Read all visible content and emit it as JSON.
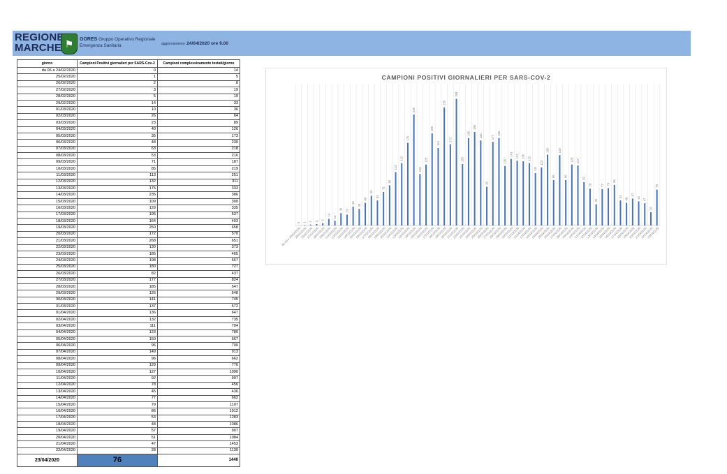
{
  "header": {
    "logo_line1": "REGIONE",
    "logo_line2": "MARCHE",
    "gores_bold": "GORES",
    "gores_line1": "Gruppo Operativo Regionale",
    "gores_line2": "Emergenza Sanitaria",
    "update_label": "aggiornamento:",
    "update_value": "24/04/2020 ore 9.00"
  },
  "table": {
    "headers": [
      "giorno",
      "Campioni Positivi giornalieri per SARS-Cov-2",
      "Campioni complessivamente testati/giorno"
    ],
    "rows": [
      [
        "da 06 a 24/02/2020",
        0,
        14
      ],
      [
        "25/02/2020",
        1,
        5
      ],
      [
        "26/02/2020",
        2,
        8
      ],
      [
        "27/02/2020",
        3,
        19
      ],
      [
        "28/02/2020",
        5,
        19
      ],
      [
        "29/02/2020",
        14,
        33
      ],
      [
        "01/03/2020",
        10,
        36
      ],
      [
        "02/03/2020",
        26,
        64
      ],
      [
        "03/03/2020",
        23,
        89
      ],
      [
        "04/03/2020",
        40,
        126
      ],
      [
        "05/03/2020",
        35,
        173
      ],
      [
        "06/03/2020",
        48,
        230
      ],
      [
        "07/03/2020",
        63,
        218
      ],
      [
        "08/03/2020",
        53,
        216
      ],
      [
        "09/03/2020",
        71,
        187
      ],
      [
        "10/03/2020",
        85,
        219
      ],
      [
        "11/03/2020",
        113,
        251
      ],
      [
        "12/03/2020",
        132,
        311
      ],
      [
        "13/03/2020",
        175,
        333
      ],
      [
        "14/03/2020",
        235,
        386
      ],
      [
        "15/03/2020",
        109,
        300
      ],
      [
        "16/03/2020",
        129,
        335
      ],
      [
        "17/03/2020",
        195,
        537
      ],
      [
        "18/03/2020",
        164,
        403
      ],
      [
        "19/03/2020",
        250,
        658
      ],
      [
        "20/03/2020",
        172,
        570
      ],
      [
        "21/03/2020",
        268,
        651
      ],
      [
        "22/03/2020",
        130,
        373
      ],
      [
        "23/03/2020",
        185,
        465
      ],
      [
        "24/03/2020",
        198,
        667
      ],
      [
        "25/03/2020",
        180,
        727
      ],
      [
        "26/03/2020",
        82,
        437
      ],
      [
        "27/03/2020",
        177,
        824
      ],
      [
        "28/03/2020",
        185,
        547
      ],
      [
        "29/03/2020",
        126,
        548
      ],
      [
        "30/03/2020",
        141,
        745
      ],
      [
        "31/03/2020",
        137,
        572
      ],
      [
        "01/04/2020",
        136,
        647
      ],
      [
        "02/04/2020",
        132,
        735
      ],
      [
        "03/04/2020",
        111,
        794
      ],
      [
        "04/04/2020",
        123,
        780
      ],
      [
        "05/04/2020",
        150,
        667
      ],
      [
        "06/04/2020",
        96,
        700
      ],
      [
        "07/04/2020",
        149,
        913
      ],
      [
        "08/04/2020",
        96,
        662
      ],
      [
        "09/04/2020",
        129,
        776
      ],
      [
        "10/04/2020",
        127,
        1090
      ],
      [
        "11/04/2020",
        92,
        997
      ],
      [
        "12/04/2020",
        78,
        456
      ],
      [
        "13/04/2020",
        45,
        436
      ],
      [
        "14/04/2020",
        77,
        662
      ],
      [
        "15/04/2020",
        79,
        1107
      ],
      [
        "16/04/2020",
        86,
        1012
      ],
      [
        "17/04/2020",
        53,
        1283
      ],
      [
        "18/04/2020",
        48,
        1086
      ],
      [
        "19/04/2020",
        57,
        907
      ],
      [
        "20/04/2020",
        51,
        1084
      ],
      [
        "21/04/2020",
        47,
        1453
      ],
      [
        "22/04/2020",
        28,
        1130
      ]
    ],
    "last_row": [
      "23/04/2020",
      76,
      1440
    ]
  },
  "colors": {
    "banner": "#8db4e2",
    "bar": "#4472c4",
    "highlight_cell": "#4f81bd"
  },
  "chart_data": {
    "type": "bar",
    "title": "CAMPIONI POSITIVI GIORNALIERI PER SARS-COV-2",
    "xlabel": "",
    "ylabel": "",
    "ylim": [
      0,
      300
    ],
    "grid": "vertical",
    "legend": "none",
    "categories": [
      "da 06 a 24/02/2020",
      "25/02/2020",
      "26/02/2020",
      "27/02/2020",
      "28/02/2020",
      "29/02/2020",
      "01/03/2020",
      "02/03/2020",
      "03/03/2020",
      "04/03/2020",
      "05/03/2020",
      "06/03/2020",
      "07/03/2020",
      "08/03/2020",
      "09/03/2020",
      "10/03/2020",
      "11/03/2020",
      "12/03/2020",
      "13/03/2020",
      "14/03/2020",
      "15/03/2020",
      "16/03/2020",
      "17/03/2020",
      "18/03/2020",
      "19/03/2020",
      "20/03/2020",
      "21/03/2020",
      "22/03/2020",
      "23/03/2020",
      "24/03/2020",
      "25/03/2020",
      "26/03/2020",
      "27/03/2020",
      "28/03/2020",
      "29/03/2020",
      "30/03/2020",
      "31/03/2020",
      "01/04/2020",
      "02/04/2020",
      "03/04/2020",
      "04/04/2020",
      "05/04/2020",
      "06/04/2020",
      "07/04/2020",
      "08/04/2020",
      "09/04/2020",
      "10/04/2020",
      "11/04/2020",
      "12/04/2020",
      "13/04/2020",
      "14/04/2020",
      "15/04/2020",
      "16/04/2020",
      "17/04/2020",
      "18/04/2020",
      "19/04/2020",
      "20/04/2020",
      "21/04/2020",
      "22/04/2020",
      "23/04/2020"
    ],
    "values": [
      0,
      1,
      2,
      3,
      5,
      14,
      10,
      26,
      23,
      40,
      35,
      48,
      63,
      53,
      71,
      85,
      113,
      132,
      175,
      235,
      109,
      129,
      195,
      164,
      250,
      172,
      268,
      130,
      185,
      198,
      180,
      82,
      177,
      185,
      126,
      141,
      137,
      136,
      132,
      111,
      123,
      150,
      96,
      149,
      96,
      129,
      127,
      92,
      78,
      45,
      77,
      79,
      86,
      53,
      48,
      57,
      51,
      47,
      28,
      76
    ]
  }
}
